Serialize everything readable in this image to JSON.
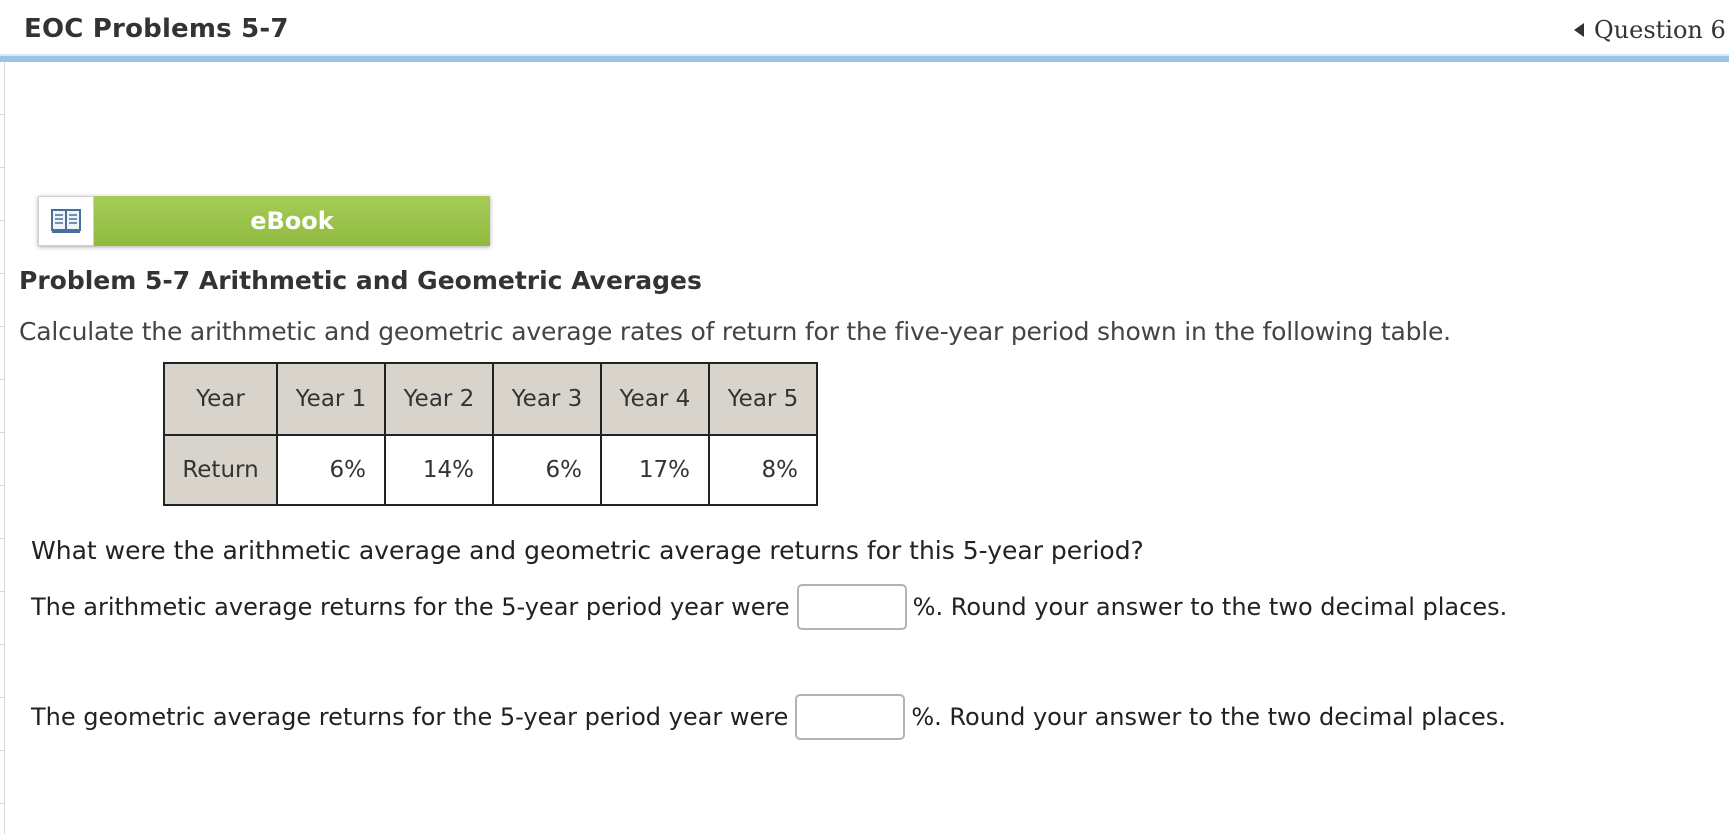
{
  "header": {
    "title": "EOC Problems 5-7",
    "question_nav": "Question 6 o"
  },
  "ebook": {
    "label": "eBook",
    "icon": "open-book-icon"
  },
  "problem": {
    "title": "Problem 5-7 Arithmetic and Geometric Averages",
    "prompt": "Calculate the arithmetic and geometric average rates of return for the five-year period shown in the following table."
  },
  "table": {
    "header_label": "Year",
    "row_label": "Return",
    "columns": [
      "Year 1",
      "Year 2",
      "Year 3",
      "Year 4",
      "Year 5"
    ],
    "values": [
      "6%",
      "14%",
      "6%",
      "17%",
      "8%"
    ]
  },
  "question": {
    "text": "What were the arithmetic average and geometric average returns for this 5-year period?",
    "arithmetic": {
      "before": "The arithmetic average returns for the 5-year period year were",
      "after": "%. Round your answer to the two decimal places.",
      "value": ""
    },
    "geometric": {
      "before": "The geometric average returns for the 5-year period year were",
      "after": "%. Round your answer to the two decimal places.",
      "value": ""
    }
  },
  "colors": {
    "header_bar": "#9cc2e6",
    "ebook_green": "#9bc54d",
    "table_header_bg": "#d8d4cc"
  }
}
